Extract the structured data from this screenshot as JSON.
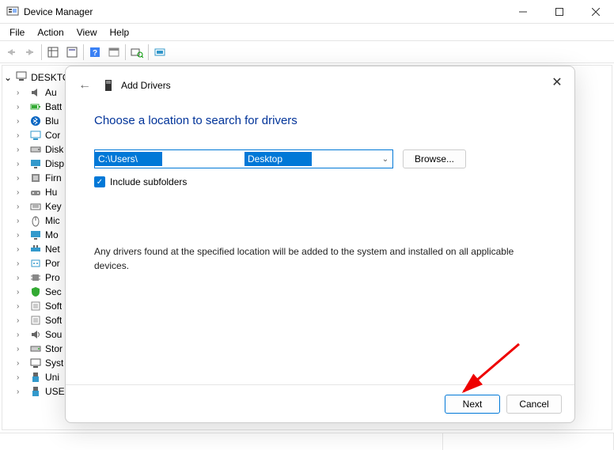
{
  "window": {
    "title": "Device Manager"
  },
  "menu": {
    "file": "File",
    "action": "Action",
    "view": "View",
    "help": "Help"
  },
  "tree": {
    "root": "DESKTO",
    "items": [
      {
        "icon": "audio",
        "label": "Au"
      },
      {
        "icon": "battery",
        "label": "Batt"
      },
      {
        "icon": "bluetooth",
        "label": "Blu"
      },
      {
        "icon": "computer",
        "label": "Cor"
      },
      {
        "icon": "disk",
        "label": "Disk"
      },
      {
        "icon": "display",
        "label": "Disp"
      },
      {
        "icon": "firmware",
        "label": "Firn"
      },
      {
        "icon": "hid",
        "label": "Hu"
      },
      {
        "icon": "keyboard",
        "label": "Key"
      },
      {
        "icon": "mouse",
        "label": "Mic"
      },
      {
        "icon": "monitor",
        "label": "Mo"
      },
      {
        "icon": "network",
        "label": "Net"
      },
      {
        "icon": "port",
        "label": "Por"
      },
      {
        "icon": "processor",
        "label": "Pro"
      },
      {
        "icon": "security",
        "label": "Sec"
      },
      {
        "icon": "software",
        "label": "Soft"
      },
      {
        "icon": "software",
        "label": "Soft"
      },
      {
        "icon": "sound",
        "label": "Sou"
      },
      {
        "icon": "storage",
        "label": "Stor"
      },
      {
        "icon": "system",
        "label": "Syst"
      },
      {
        "icon": "usb",
        "label": "Uni"
      },
      {
        "icon": "usb",
        "label": "USE"
      }
    ]
  },
  "dialog": {
    "title": "Add Drivers",
    "heading": "Choose a location to search for drivers",
    "path_prefix": "C:\\Users\\",
    "path_suffix": "Desktop",
    "browse": "Browse...",
    "checkbox": "Include subfolders",
    "info": "Any drivers found at the specified location will be added to the system and installed on all applicable devices.",
    "next": "Next",
    "cancel": "Cancel"
  }
}
